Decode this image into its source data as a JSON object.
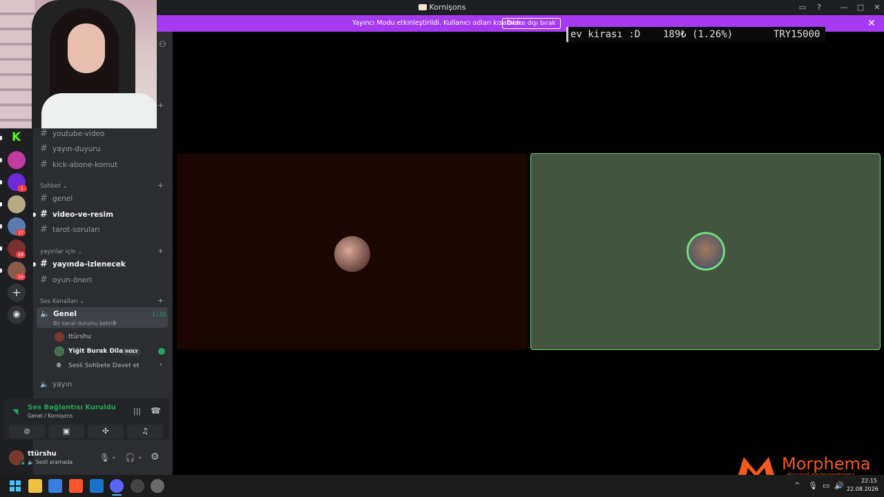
{
  "window": {
    "title": "Kornişons"
  },
  "banner": {
    "message": "Yayıncı Modu etkinleştirildi. Kullanıcı adları kısaltıldı.",
    "button": "Devre dışı bırak"
  },
  "ticker": {
    "text": "ev kirası :D",
    "amount": "189₺ (1.26%)",
    "goal": "TRY15000"
  },
  "channels": {
    "top": [
      {
        "name": "youtube-video"
      },
      {
        "name": "yayın-duyuru"
      },
      {
        "name": "kick-abone-komut"
      }
    ],
    "sohbet": {
      "label": "Sohbet",
      "items": [
        {
          "name": "genel"
        },
        {
          "name": "video-ve-resim"
        },
        {
          "name": "tarot-soruları"
        }
      ]
    },
    "yayinlar": {
      "label": "yayınlar için",
      "items": [
        {
          "name": "yayında-izlenecek"
        },
        {
          "name": "oyun-öneri"
        }
      ]
    },
    "voice": {
      "label": "Ses Kanalları",
      "active": {
        "name": "Genel",
        "timer": "1:31",
        "status": "Bir kanal durumu belirle"
      },
      "users": [
        {
          "name": "ttürshu"
        },
        {
          "name": "Yiğit Burak Dilaver",
          "badge": "HOLY"
        }
      ],
      "invite": "Sesli Sohbete Davet et",
      "other": "yayın"
    }
  },
  "servers": {
    "badges": [
      "1",
      "17",
      "28",
      "16"
    ],
    "kick_label": "K"
  },
  "voice_panel": {
    "status": "Ses Bağlantısı Kuruldu",
    "location": "Genel / Kornişons"
  },
  "user": {
    "name": "ttürshu",
    "status": "Sesli aramada"
  },
  "branding": {
    "name": "Morphema",
    "url": "discord.gg/morphema"
  },
  "clock": {
    "time": "22:15",
    "date": "22.08.2026"
  },
  "colors": {
    "accent": "#a53af0",
    "speaking": "#6ee07a",
    "online": "#23a55a"
  }
}
